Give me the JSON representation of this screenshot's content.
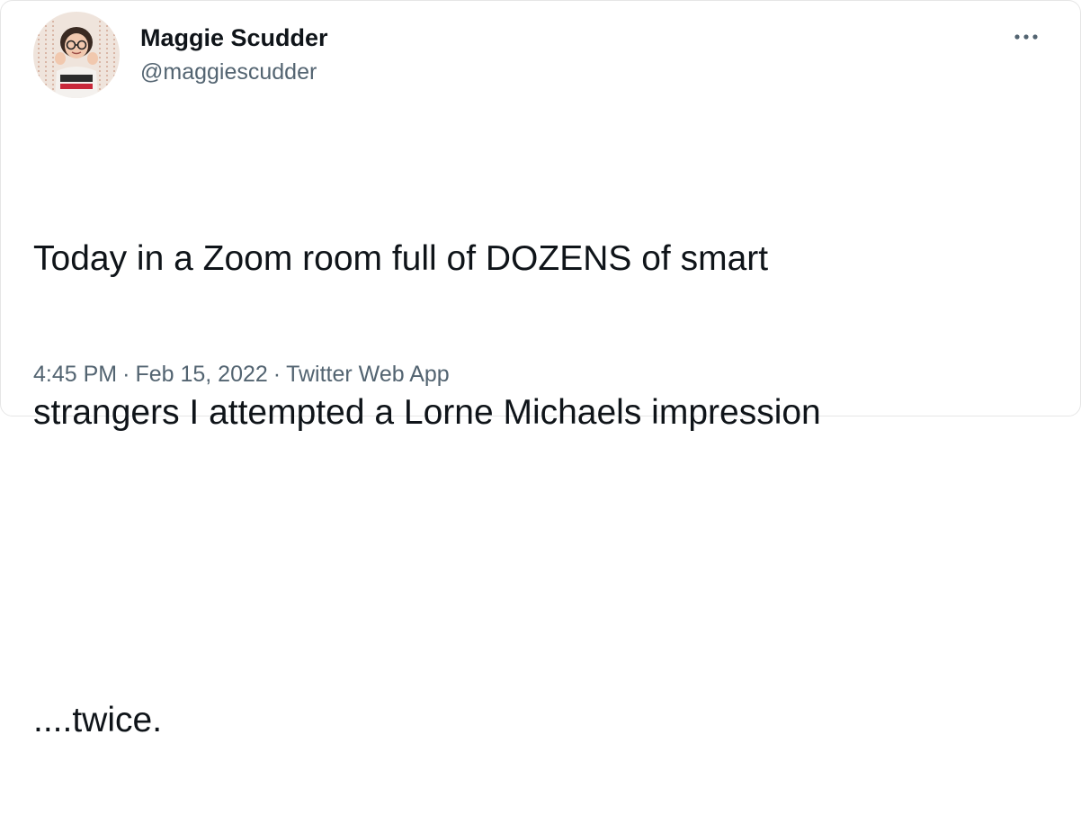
{
  "tweet": {
    "author": {
      "display_name": "Maggie Scudder",
      "handle": "@maggiescudder",
      "avatar_icon": "profile-photo"
    },
    "more_icon": "more-horizontal-icon",
    "text_lines": [
      "Today in a Zoom room full of DOZENS of smart",
      "strangers I attempted a Lorne Michaels impression",
      "",
      "....twice."
    ],
    "time": "4:45 PM",
    "date": "Feb 15, 2022",
    "source": "Twitter Web App",
    "separator": "·"
  },
  "colors": {
    "text_primary": "#0f1419",
    "text_secondary": "#536471",
    "border": "#e6e6e6"
  }
}
